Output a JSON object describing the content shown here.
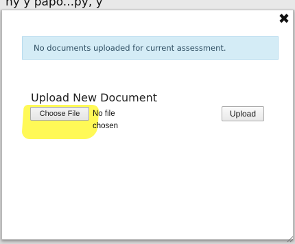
{
  "background": {
    "text": "ny                                           y papo...py, y"
  },
  "dialog": {
    "close_icon": "✖",
    "banner_text": "No documents uploaded for current assessment.",
    "section_title": "Upload New Document",
    "file_input": {
      "button_label": "Choose File",
      "status_text": "No file chosen"
    },
    "upload_label": "Upload"
  },
  "colors": {
    "banner_bg": "#d4ecf6",
    "highlight": "#fff728"
  }
}
